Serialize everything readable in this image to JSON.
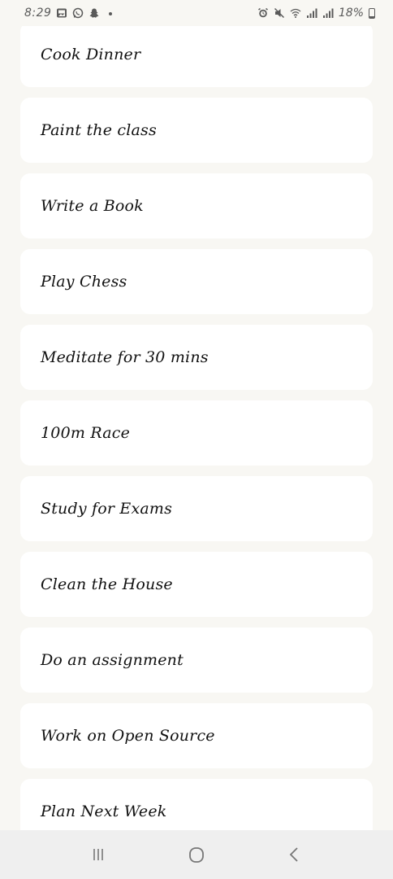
{
  "status_bar": {
    "time": "8:29",
    "battery_percent": "18%",
    "battery_level": 0.18,
    "left_icons": [
      "gallery-icon",
      "whatsapp-icon",
      "snapchat-icon",
      "dot-icon"
    ],
    "right_icons": [
      "alarm-icon",
      "mute-icon",
      "wifi-icon",
      "signal-icon",
      "signal-icon",
      "battery-icon"
    ]
  },
  "tasks": [
    {
      "label": "Cook Dinner"
    },
    {
      "label": "Paint the class"
    },
    {
      "label": "Write a Book"
    },
    {
      "label": "Play Chess"
    },
    {
      "label": "Meditate for 30 mins"
    },
    {
      "label": "100m Race"
    },
    {
      "label": "Study for Exams"
    },
    {
      "label": "Clean the House"
    },
    {
      "label": "Do an assignment"
    },
    {
      "label": "Work on Open Source"
    },
    {
      "label": "Plan Next Week"
    }
  ],
  "nav_bar": {
    "buttons": [
      "recent-apps-icon",
      "home-icon",
      "back-icon"
    ]
  },
  "colors": {
    "background": "#f8f7f3",
    "card": "#ffffff",
    "text": "#111111",
    "nav_bar": "#efefef"
  }
}
